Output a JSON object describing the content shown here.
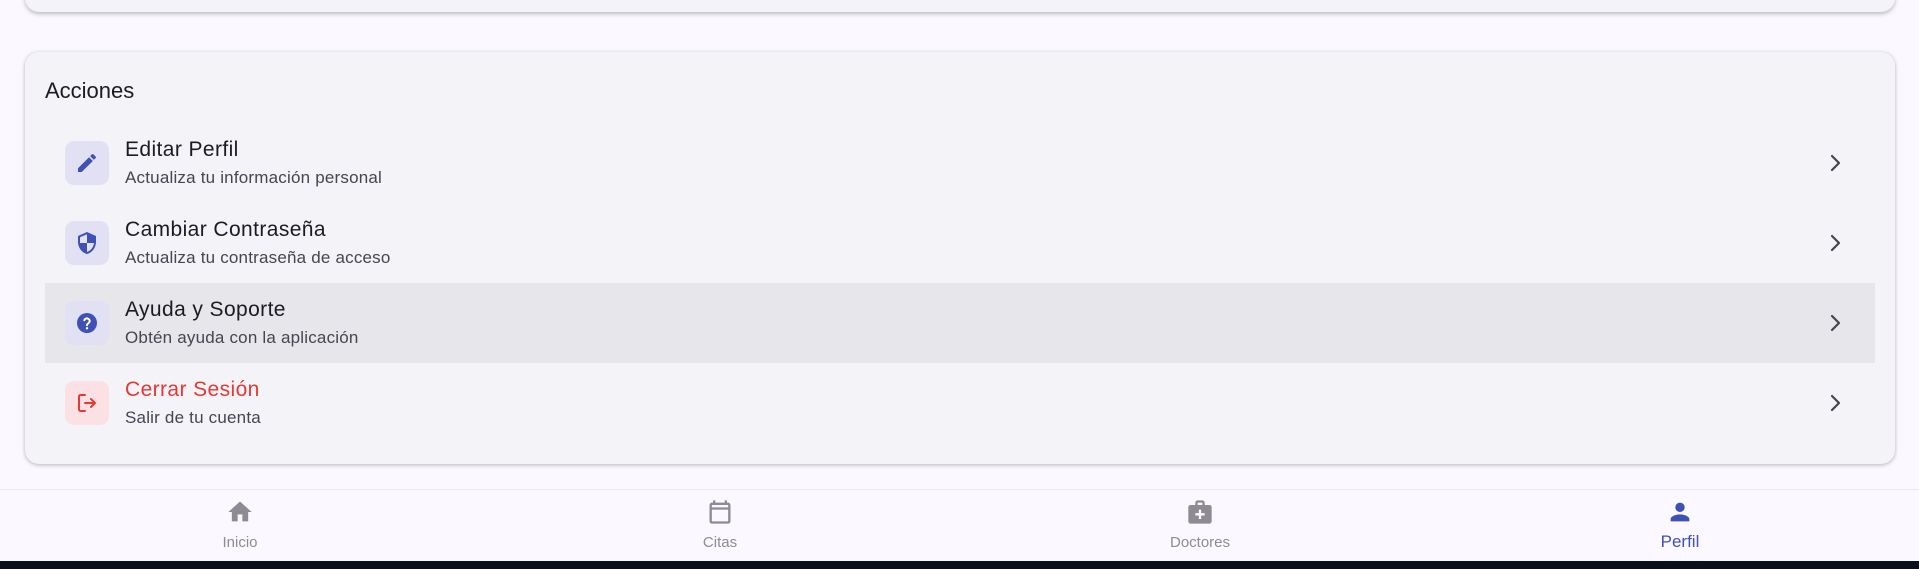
{
  "section": {
    "title": "Acciones"
  },
  "actions": [
    {
      "title": "Editar Perfil",
      "subtitle": "Actualiza tu información personal",
      "icon": "edit-pencil-icon"
    },
    {
      "title": "Cambiar Contraseña",
      "subtitle": "Actualiza tu contraseña de acceso",
      "icon": "shield-icon"
    },
    {
      "title": "Ayuda y Soporte",
      "subtitle": "Obtén ayuda con la aplicación",
      "icon": "help-circle-icon"
    },
    {
      "title": "Cerrar Sesión",
      "subtitle": "Salir de tu cuenta",
      "icon": "logout-icon"
    }
  ],
  "bottom_nav": {
    "items": [
      {
        "label": "Inicio",
        "icon": "home-icon"
      },
      {
        "label": "Citas",
        "icon": "calendar-icon"
      },
      {
        "label": "Doctores",
        "icon": "medical-bag-icon"
      },
      {
        "label": "Perfil",
        "icon": "person-icon"
      }
    ],
    "active": "Perfil"
  },
  "colors": {
    "accent": "#3f51b5",
    "danger": "#e53935",
    "card_bg": "#f3f3f8",
    "page_bg": "#fbf8ff",
    "inactive": "#8c8c92"
  }
}
